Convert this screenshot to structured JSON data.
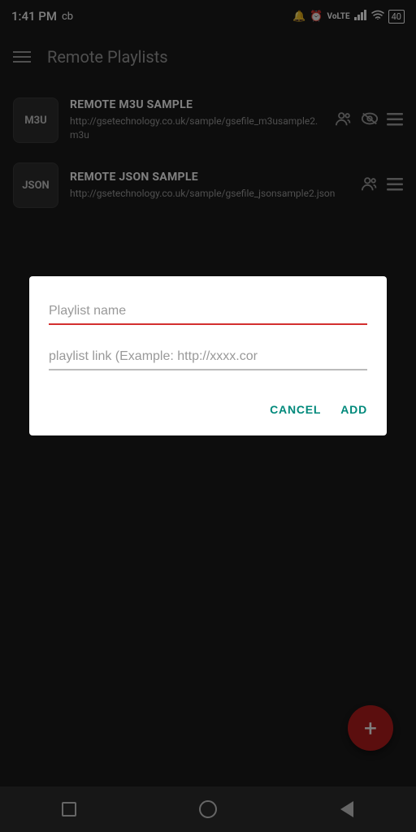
{
  "status_bar": {
    "time": "1:41 PM",
    "carrier": "cb",
    "battery": "40"
  },
  "app_bar": {
    "title": "Remote Playlists"
  },
  "playlists": [
    {
      "id": "m3u",
      "badge": "M3U",
      "name": "REMOTE M3U SAMPLE",
      "url": "http://gsetechnology.co.uk/sample/gsefile_m3usample2.m3u",
      "has_eye": true
    },
    {
      "id": "json",
      "badge": "JSON",
      "name": "REMOTE JSON SAMPLE",
      "url": "http://gsetechnology.co.uk/sample/gsefile_jsonsample2.json",
      "has_eye": false
    }
  ],
  "dialog": {
    "name_placeholder": "Playlist name",
    "link_placeholder": "playlist link (Example: http://xxxx.cor",
    "cancel_label": "CANCEL",
    "add_label": "ADD"
  },
  "fab": {
    "label": "+"
  }
}
